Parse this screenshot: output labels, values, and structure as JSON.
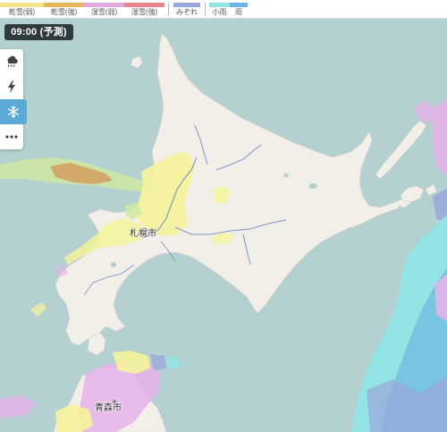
{
  "legend": {
    "items": [
      {
        "label": "乾雪(弱)",
        "color": "#f1e38a"
      },
      {
        "label": "乾雪(強)",
        "color": "#e6b75a"
      },
      {
        "label": "湿雪(弱)",
        "color": "#e0a9e0"
      },
      {
        "label": "湿雪(強)",
        "color": "#e9848c"
      },
      {
        "label": "みぞれ",
        "color": "#9aa7dc"
      },
      {
        "label": "小雨",
        "color": "#93e6e1"
      },
      {
        "label": "雨",
        "color": "#6db3e4"
      }
    ]
  },
  "time_badge": "09:00 (予測)",
  "controls": [
    {
      "icon": "rain-cloud-icon",
      "active": false
    },
    {
      "icon": "lightning-icon",
      "active": false
    },
    {
      "icon": "snowflake-icon",
      "active": true
    },
    {
      "icon": "more-icon",
      "active": false
    }
  ],
  "cities": {
    "sapporo": "札幌市",
    "aomori": "青森市"
  },
  "colors": {
    "sea": "#b4d0d1",
    "land": "#f2efe9",
    "snow_dry_light": "#f5f39a",
    "snow_dry_heavy": "#d9a560",
    "snow_wet_light": "#e6b3ea",
    "drizzle": "#8fe6e6",
    "rain": "#6cb6e0",
    "sleet": "#9aa7dc",
    "river": "#7f93c4",
    "active_control": "#5aa9d6"
  }
}
